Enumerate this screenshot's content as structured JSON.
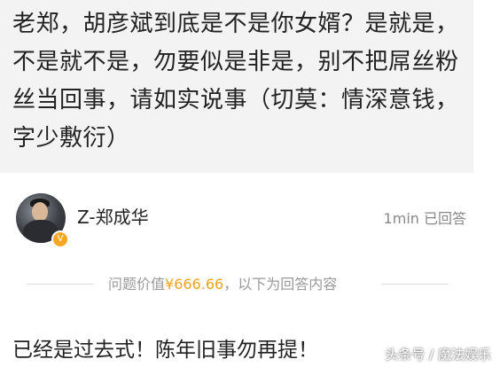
{
  "question": {
    "text": "老郑，胡彦斌到底是不是你女婿？是就是，不是就不是，勿要似是非是，别不把屌丝粉丝当回事，请如实说事（切莫：情深意钱，字少敷衍）"
  },
  "answer_header": {
    "username": "Z-郑成华",
    "time": "1min 已回答",
    "avatar_icon": "user-avatar",
    "badge_icon": "verified-badge-icon",
    "badge_color": "#f5a623"
  },
  "reward": {
    "prefix": "问题价值",
    "price": "¥666.66",
    "suffix": "，以下为回答内容",
    "price_color": "#f0a31c"
  },
  "answer": {
    "text": "已经是过去式！陈年旧事勿再提！"
  },
  "watermark": {
    "text": "头条号 / 魔法娱乐"
  }
}
